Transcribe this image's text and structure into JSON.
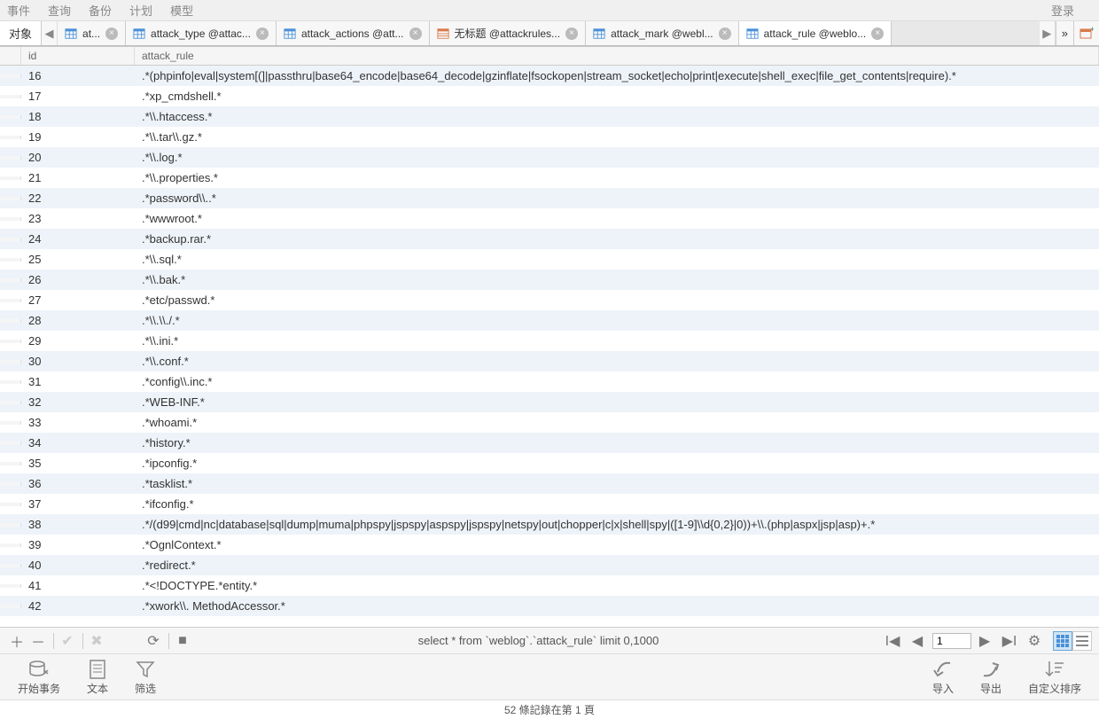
{
  "menu": {
    "items": [
      "事件",
      "查询",
      "备份",
      "计划",
      "模型"
    ],
    "login": "登录"
  },
  "leftTab": "对象",
  "tabs": [
    {
      "label": "at...",
      "icon": "table"
    },
    {
      "label": "attack_type @attac...",
      "icon": "table"
    },
    {
      "label": "attack_actions @att...",
      "icon": "table"
    },
    {
      "label": "无标题 @attackrules...",
      "icon": "query"
    },
    {
      "label": "attack_mark @webl...",
      "icon": "table"
    },
    {
      "label": "attack_rule @weblo...",
      "icon": "table",
      "active": true
    }
  ],
  "columns": {
    "id": "id",
    "rule": "attack_rule"
  },
  "rows": [
    {
      "id": "16",
      "rule": ".*(phpinfo|eval|system[(]|passthru|base64_encode|base64_decode|gzinflate|fsockopen|stream_socket|echo|print|execute|shell_exec|file_get_contents|require).*"
    },
    {
      "id": "17",
      "rule": ".*xp_cmdshell.*"
    },
    {
      "id": "18",
      "rule": ".*\\\\.htaccess.*"
    },
    {
      "id": "19",
      "rule": ".*\\\\.tar\\\\.gz.*"
    },
    {
      "id": "20",
      "rule": ".*\\\\.log.*"
    },
    {
      "id": "21",
      "rule": ".*\\\\.properties.*"
    },
    {
      "id": "22",
      "rule": ".*password\\\\..*"
    },
    {
      "id": "23",
      "rule": ".*wwwroot.*"
    },
    {
      "id": "24",
      "rule": ".*backup.rar.*"
    },
    {
      "id": "25",
      "rule": ".*\\\\.sql.*"
    },
    {
      "id": "26",
      "rule": ".*\\\\.bak.*"
    },
    {
      "id": "27",
      "rule": ".*etc/passwd.*"
    },
    {
      "id": "28",
      "rule": ".*\\\\.\\\\./.*"
    },
    {
      "id": "29",
      "rule": ".*\\\\.ini.*"
    },
    {
      "id": "30",
      "rule": ".*\\\\.conf.*"
    },
    {
      "id": "31",
      "rule": ".*config\\\\.inc.*"
    },
    {
      "id": "32",
      "rule": ".*WEB-INF.*"
    },
    {
      "id": "33",
      "rule": ".*whoami.*"
    },
    {
      "id": "34",
      "rule": ".*history.*"
    },
    {
      "id": "35",
      "rule": ".*ipconfig.*"
    },
    {
      "id": "36",
      "rule": ".*tasklist.*"
    },
    {
      "id": "37",
      "rule": ".*ifconfig.*"
    },
    {
      "id": "38",
      "rule": ".*/(d99|cmd|nc|database|sql|dump|muma|phpspy|jspspy|aspspy|jspspy|netspy|out|chopper|c|x|shell|spy|([1-9]\\\\d{0,2}|0))+\\\\.(php|aspx|jsp|asp)+.*"
    },
    {
      "id": "39",
      "rule": ".*OgnlContext.*"
    },
    {
      "id": "40",
      "rule": ".*redirect.*"
    },
    {
      "id": "41",
      "rule": ".*<!DOCTYPE.*entity.*"
    },
    {
      "id": "42",
      "rule": ".*xwork\\\\. MethodAccessor.*"
    }
  ],
  "sql": "select * from `weblog`.`attack_rule`  limit 0,1000",
  "page": "1",
  "actions": {
    "begin": "开始事务",
    "text": "文本",
    "filter": "筛选",
    "import": "导入",
    "export": "导出",
    "sort": "自定义排序"
  },
  "status": "52 條記錄在第 1 頁"
}
